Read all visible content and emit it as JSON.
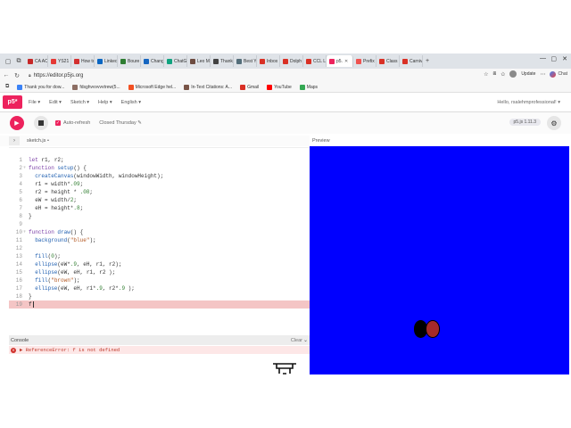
{
  "browser": {
    "tabs": [
      {
        "label": "CA ACI",
        "color": "#c62828"
      },
      {
        "label": "YS21",
        "color": "#e53935"
      },
      {
        "label": "How to",
        "color": "#d32f2f"
      },
      {
        "label": "Linked",
        "color": "#0a66c2"
      },
      {
        "label": "Boure",
        "color": "#2e7d32"
      },
      {
        "label": "Chang",
        "color": "#1565c0"
      },
      {
        "label": "ChatG",
        "color": "#10a37f"
      },
      {
        "label": "Leo Mi",
        "color": "#6d4c41"
      },
      {
        "label": "Thank",
        "color": "#424242"
      },
      {
        "label": "Best Yo",
        "color": "#546e7a"
      },
      {
        "label": "Inbox",
        "color": "#d93025"
      },
      {
        "label": "Dolph",
        "color": "#d93025"
      },
      {
        "label": "CCL LE",
        "color": "#d93025"
      },
      {
        "label": "p5.",
        "color": "#ed225d",
        "active": true
      },
      {
        "label": "Prefix",
        "color": "#ef5350"
      },
      {
        "label": "Class F",
        "color": "#d93025"
      },
      {
        "label": "Carniv",
        "color": "#d93025"
      }
    ],
    "new_tab": "+",
    "url": "https://editor.p5js.org",
    "update_label": "Update",
    "chat_label": "Chat",
    "bookmarks": [
      {
        "label": "Thank you for dow...",
        "color": "#3b82f6"
      },
      {
        "label": "fdsghvvvvvvtrew(5...",
        "color": "#8d6e63"
      },
      {
        "label": "Microsoft Edge hel...",
        "color": "#f25022"
      },
      {
        "label": "In-Text Citations: A...",
        "color": "#795548"
      },
      {
        "label": "Gmail",
        "color": "#d93025"
      },
      {
        "label": "YouTube",
        "color": "#ff0000"
      },
      {
        "label": "Maps",
        "color": "#34a853"
      }
    ]
  },
  "p5": {
    "logo": "p5*",
    "menu": [
      "File ▾",
      "Edit ▾",
      "Sketch ▾",
      "Help ▾",
      "English ▾"
    ],
    "user": "Hello, rsalehmprofessional! ▾",
    "auto_refresh": "Auto-refresh",
    "sketch_name": "Closed Thursday ✎",
    "version": "p5.js 1.11.3",
    "file_tab": "sketch.js",
    "file_dot": "•",
    "preview_label": "Preview",
    "console_label": "Console",
    "clear_label": "Clear",
    "error_text": "▶ ReferenceError: f is not defined",
    "preview_bg": "#0000ff",
    "ellipse_fill_1": "#000000",
    "ellipse_fill_2": "#a52a2a"
  },
  "code": [
    {
      "n": "1",
      "t": "let r1, r2;"
    },
    {
      "n": "2",
      "t": "function setup() {",
      "fold": true
    },
    {
      "n": "3",
      "t": "  createCanvas(windowWidth, windowHeight);"
    },
    {
      "n": "4",
      "t": "  r1 = width*.09;"
    },
    {
      "n": "5",
      "t": "  r2 = height * .08;"
    },
    {
      "n": "6",
      "t": "  eW = width/2;"
    },
    {
      "n": "7",
      "t": "  eH = height*.8;"
    },
    {
      "n": "8",
      "t": "}"
    },
    {
      "n": "9",
      "t": ""
    },
    {
      "n": "10",
      "t": "function draw() {",
      "fold": true
    },
    {
      "n": "11",
      "t": "  background(\"blue\");"
    },
    {
      "n": "12",
      "t": ""
    },
    {
      "n": "13",
      "t": "  fill(0);"
    },
    {
      "n": "14",
      "t": "  ellipse(eW*.9, eH, r1, r2);"
    },
    {
      "n": "15",
      "t": "  ellipse(eW, eH, r1, r2 );"
    },
    {
      "n": "16",
      "t": "  fill(\"brown\");"
    },
    {
      "n": "17",
      "t": "  ellipse(eW, eH, r1*.9, r2*.9 );"
    },
    {
      "n": "18",
      "t": "}"
    },
    {
      "n": "19",
      "t": "f",
      "error": true
    }
  ]
}
